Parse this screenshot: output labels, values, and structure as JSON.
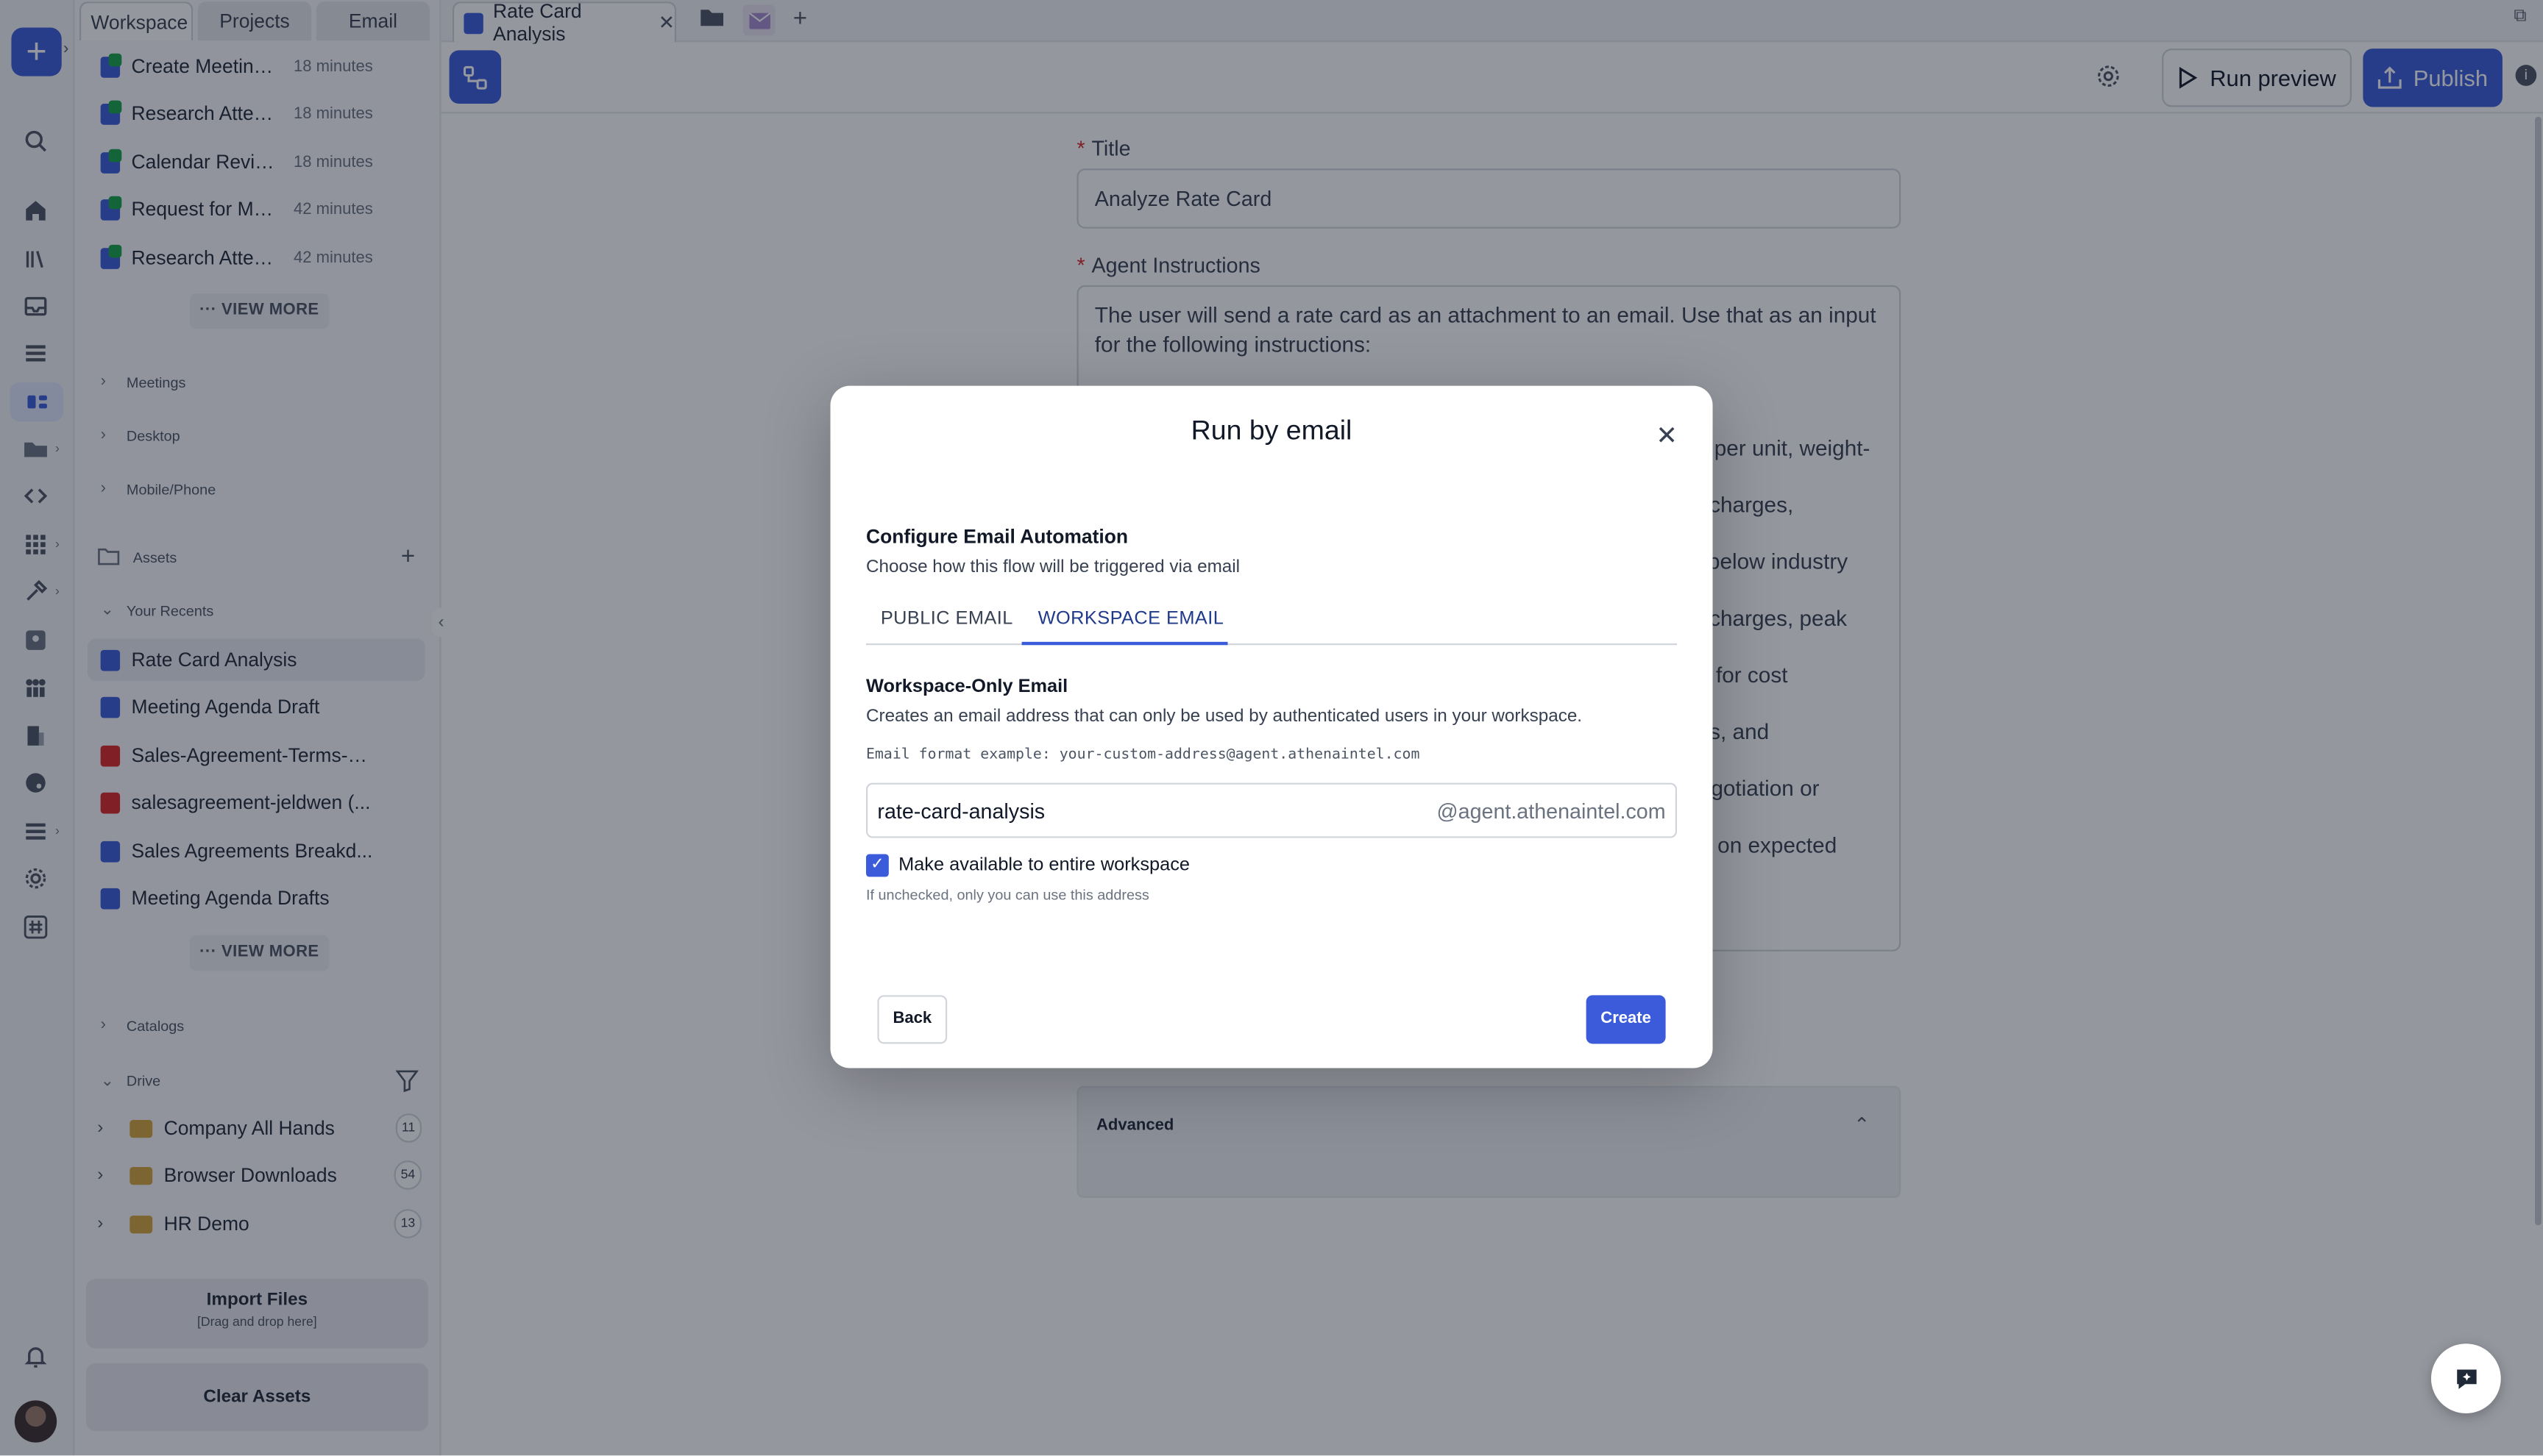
{
  "sidebar": {
    "tabs": [
      "Workspace",
      "Projects",
      "Email"
    ],
    "recent_flows": [
      {
        "name": "Create Meeting ...",
        "time": "18 minutes"
      },
      {
        "name": "Research Atten...",
        "time": "18 minutes"
      },
      {
        "name": "Calendar Revie...",
        "time": "18 minutes"
      },
      {
        "name": "Request for Me...",
        "time": "42 minutes"
      },
      {
        "name": "Research Atten...",
        "time": "42 minutes"
      }
    ],
    "view_more": "VIEW MORE",
    "sections": [
      "Meetings",
      "Desktop",
      "Mobile/Phone"
    ],
    "assets_label": "Assets",
    "recents_label": "Your Recents",
    "recents": [
      {
        "name": "Rate Card Analysis",
        "type": "doc"
      },
      {
        "name": "Meeting Agenda Draft",
        "type": "doc"
      },
      {
        "name": "Sales-Agreement-Terms-a...",
        "type": "pdf"
      },
      {
        "name": "salesagreement-jeldwen (...",
        "type": "pdf"
      },
      {
        "name": "Sales Agreements Breakd...",
        "type": "doc"
      },
      {
        "name": "Meeting Agenda Drafts",
        "type": "doc"
      }
    ],
    "catalogs_label": "Catalogs",
    "drive_label": "Drive",
    "drive_folders": [
      {
        "name": "Company All Hands",
        "count": "11"
      },
      {
        "name": "Browser Downloads",
        "count": "54"
      },
      {
        "name": "HR Demo",
        "count": "13"
      }
    ],
    "import_title": "Import Files",
    "import_sub": "[Drag and drop here]",
    "clear_assets": "Clear Assets"
  },
  "topbar": {
    "tab_label": "Rate Card Analysis",
    "tab_close": "✕",
    "add_tab": "+"
  },
  "header": {
    "run_preview": "Run preview",
    "publish": "Publish"
  },
  "form": {
    "title_label": "Title",
    "title_value": "Analyze Rate Card",
    "instructions_label": "Agent Instructions",
    "instructions_text": "The user will send a rate card as an attachment to an email. Use that as an input for the following instructions:",
    "visible_fragments": [
      "per unit, weight-",
      "charges,",
      "below industry",
      "charges, peak",
      "for cost",
      "s, and",
      "gotiation or",
      "on expected"
    ],
    "advanced_label": "Advanced"
  },
  "modal": {
    "title": "Run by email",
    "heading": "Configure Email Automation",
    "subheading": "Choose how this flow will be triggered via email",
    "tabs": [
      "PUBLIC EMAIL",
      "WORKSPACE EMAIL"
    ],
    "active_tab": "WORKSPACE EMAIL",
    "section_title": "Workspace-Only Email",
    "section_desc": "Creates an email address that can only be used by authenticated users in your workspace.",
    "format_example": "Email format example: your-custom-address@agent.athenaintel.com",
    "address_value": "rate-card-analysis",
    "address_suffix": "@agent.athenaintel.com",
    "checkbox_label": "Make available to entire workspace",
    "checkbox_checked": true,
    "checkbox_hint": "If unchecked, only you can use this address",
    "back": "Back",
    "create": "Create"
  },
  "colors": {
    "accent": "#3b5bdb",
    "overlay": "rgba(17,24,39,0.45)"
  }
}
